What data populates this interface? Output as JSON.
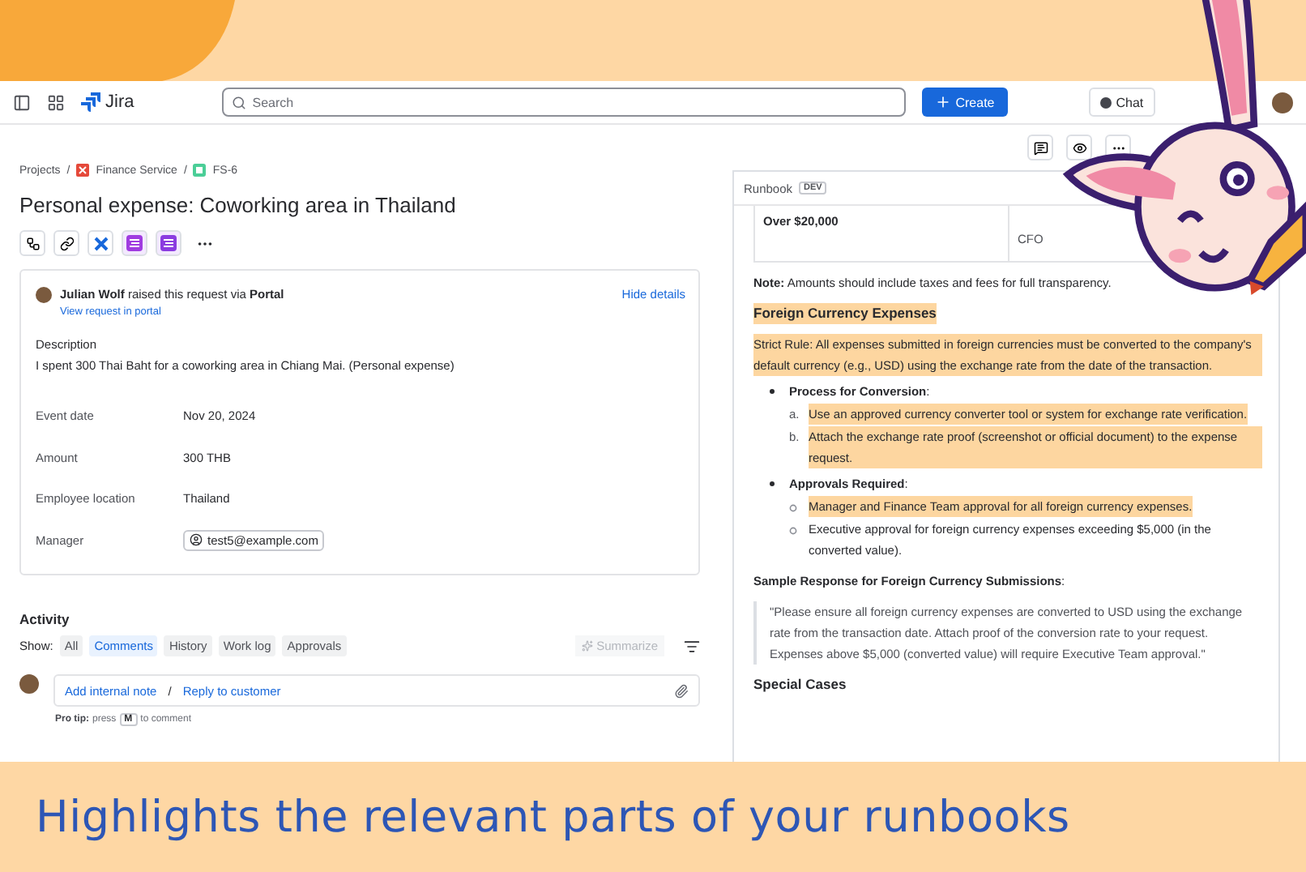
{
  "nav": {
    "app_name": "Jira",
    "search_placeholder": "Search",
    "create_label": "Create",
    "chat_label": "Chat"
  },
  "breadcrumbs": [
    {
      "label": "Projects",
      "kind": "text"
    },
    {
      "separator": "/",
      "label": "Finance Service",
      "kind": "project"
    },
    {
      "separator": "/",
      "label": "FS-6",
      "kind": "issue"
    }
  ],
  "issue": {
    "title": "Personal expense: Coworking area in Thailand",
    "request": {
      "sentence": "**Julian Wolf** raised this request via **Portal**",
      "link": "View request in portal",
      "toggle": "Hide details"
    },
    "description_label": "Description",
    "description": "I spent 300 Thai Baht for a coworking area in Chiang Mai. (Personal expense)",
    "fields": [
      {
        "label": "Event date",
        "value": "Nov 20, 2024",
        "kind": "text"
      },
      {
        "label": "Amount",
        "value": "300 THB",
        "kind": "text"
      },
      {
        "label": "Employee location",
        "value": "Thailand",
        "kind": "text"
      },
      {
        "label": "Manager",
        "value": "test5@example.com",
        "kind": "user"
      }
    ]
  },
  "activity": {
    "title": "Activity",
    "show_label": "Show:",
    "filters": [
      {
        "label": "All",
        "selected": false
      },
      {
        "label": "Comments",
        "selected": true
      },
      {
        "label": "History",
        "selected": false
      },
      {
        "label": "Work log",
        "selected": false
      },
      {
        "label": "Approvals",
        "selected": false
      }
    ],
    "summarize": {
      "label": "Summarize",
      "disabled": true
    },
    "comment": {
      "internal": "Add internal note",
      "separator": "/",
      "reply": "Reply to customer"
    },
    "tip": {
      "label": "Pro tip:",
      "before": "press",
      "key": "M",
      "after": "to comment"
    }
  },
  "runbook": {
    "title": "Runbook",
    "badge": "DEV",
    "table_row": {
      "column_1": "Over $20,000",
      "column_2": "CFO"
    },
    "content": [
      {
        "kind": "paragraph",
        "text": "**Note:** Amounts should include taxes and fees for full transparency.",
        "highlighted": false
      },
      {
        "kind": "heading",
        "text": "Foreign Currency Expenses",
        "highlighted": true
      },
      {
        "kind": "paragraph",
        "text": "Strict Rule: All expenses submitted in foreign currencies must be converted to the company's default currency (e.g., USD) using the exchange rate from the date of the transaction.",
        "highlighted": true
      },
      {
        "kind": "bullet",
        "text": "**Process for Conversion**:",
        "children": [
          {
            "marker": "a.",
            "text": "Use an approved currency converter tool or system for exchange rate verification.",
            "highlighted": true
          },
          {
            "marker": "b.",
            "text": "Attach the exchange rate proof (screenshot or official document) to the expense request.",
            "highlighted": true
          }
        ]
      },
      {
        "kind": "bullet",
        "text": "**Approvals Required**:",
        "children": [
          {
            "text": "Manager and Finance Team approval for all foreign currency expenses.",
            "highlighted": true
          },
          {
            "text": "Executive approval for foreign currency expenses exceeding $5,000 (in the converted value).",
            "highlighted": false
          }
        ]
      },
      {
        "kind": "paragraph",
        "text": "**Sample Response for Foreign Currency Submissions**:",
        "highlighted": false
      },
      {
        "kind": "quote",
        "text": "\"Please ensure all foreign currency expenses are converted to USD using the exchange rate from the transaction date. Attach proof of the conversion rate to your request. Expenses above $5,000 (converted value) will require Executive Team approval.\""
      },
      {
        "kind": "heading",
        "text": "Special Cases",
        "highlighted": false
      }
    ]
  },
  "caption": "Highlights the relevant parts of your runbooks"
}
